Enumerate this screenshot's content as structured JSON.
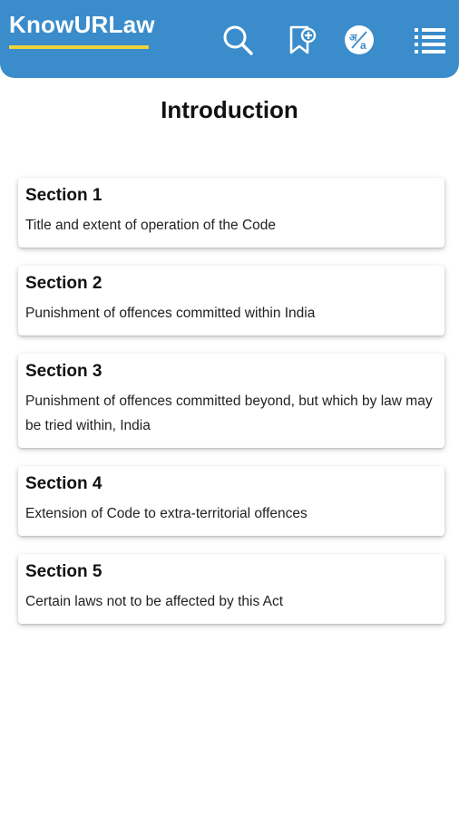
{
  "app": {
    "title": "KnowURLaw",
    "brand_underline_color": "#f0d23a",
    "bar_color": "#3a8ccb"
  },
  "toolbar": {
    "icons": [
      "search-icon",
      "bookmark-add-icon",
      "language-translate-icon",
      "list-menu-icon"
    ]
  },
  "page": {
    "title": "Introduction"
  },
  "sections": [
    {
      "title": "Section 1",
      "description": "Title and extent of operation of the Code"
    },
    {
      "title": "Section 2",
      "description": "Punishment of offences committed within India"
    },
    {
      "title": "Section 3",
      "description": "Punishment of offences committed beyond, but which by law may be tried within, India"
    },
    {
      "title": "Section 4",
      "description": "Extension of Code to extra-territorial offences"
    },
    {
      "title": "Section 5",
      "description": "Certain laws not to be affected by this Act"
    }
  ]
}
